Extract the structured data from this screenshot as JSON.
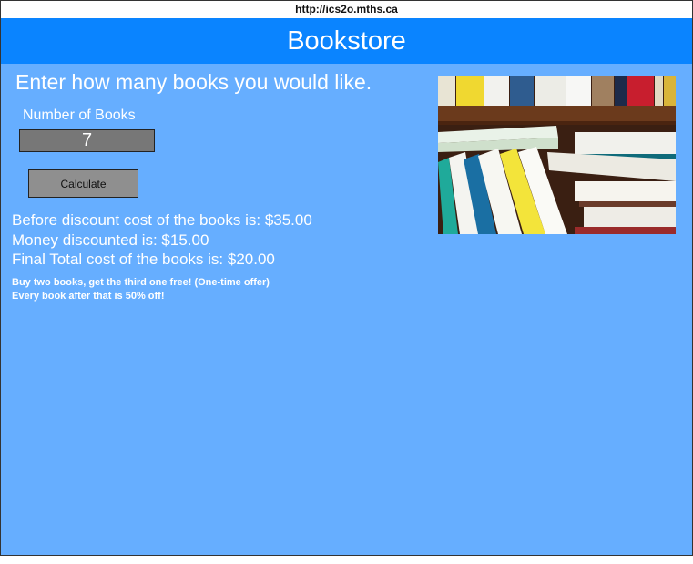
{
  "browser": {
    "url": "http://ics2o.mths.ca"
  },
  "header": {
    "title": "Bookstore"
  },
  "form": {
    "prompt": "Enter how many books you would like.",
    "field_label": "Number of Books",
    "books_value": "7",
    "calculate_label": "Calculate"
  },
  "results": {
    "before_discount": "Before discount cost of the books is: $35.00",
    "money_discounted": "Money discounted is: $15.00",
    "final_total": "Final Total cost of the books is: $20.00"
  },
  "offer": {
    "line1": "Buy two books, get the third one free! (One-time offer)",
    "line2": "Every book after that is 50% off!"
  },
  "colors": {
    "background": "#66aeff",
    "header": "#0a84ff",
    "input": "#777777",
    "button": "#8f8f8f"
  }
}
